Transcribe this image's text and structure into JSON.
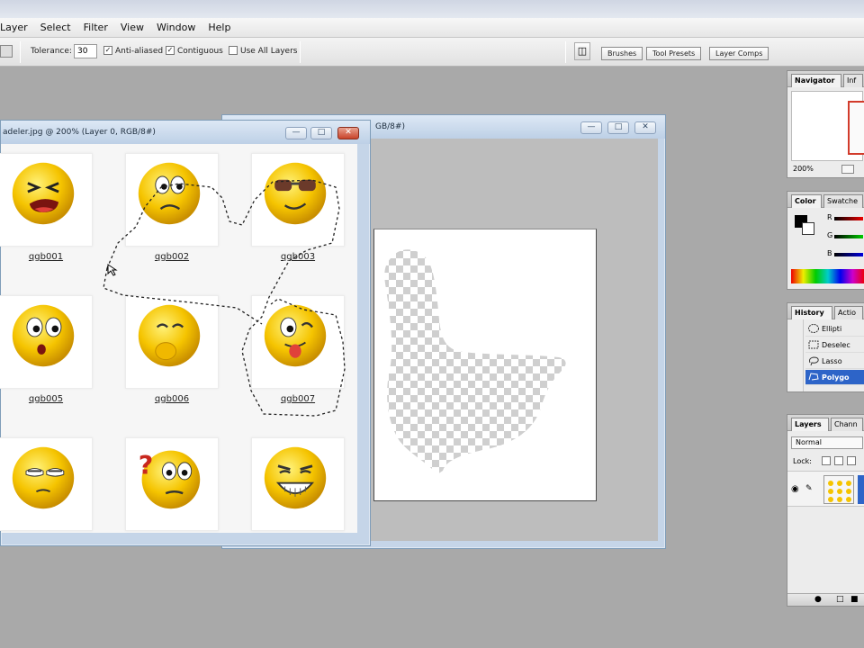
{
  "menu": [
    "Layer",
    "Select",
    "Filter",
    "View",
    "Window",
    "Help"
  ],
  "options": {
    "tolerance_label": "Tolerance:",
    "tolerance_value": "30",
    "anti_aliased_label": "Anti-aliased",
    "contiguous_label": "Contiguous",
    "use_all_layers_label": "Use All Layers",
    "anti_aliased": true,
    "contiguous": true,
    "use_all_layers": false
  },
  "palette_well": {
    "tabs": [
      "Brushes",
      "Tool Presets",
      "Layer Comps"
    ]
  },
  "windows": {
    "back": {
      "title": "GB/8#)",
      "min": "—",
      "max": "□",
      "close": "✕"
    },
    "front": {
      "title": "adeler.jpg @ 200% (Layer 0, RGB/8#)",
      "min": "—",
      "max": "□",
      "close": "✕",
      "emojis": [
        {
          "label": "qgb001",
          "expression": "squint-shout"
        },
        {
          "label": "qgb002",
          "expression": "worried"
        },
        {
          "label": "qgb003",
          "expression": "sunglasses"
        },
        {
          "label": "qgb005",
          "expression": "surprised"
        },
        {
          "label": "qgb006",
          "expression": "giggle"
        },
        {
          "label": "qgb007",
          "expression": "tongue-wink"
        },
        {
          "label": "",
          "expression": "sleepy"
        },
        {
          "label": "",
          "expression": "confused"
        },
        {
          "label": "",
          "expression": "big-grin"
        }
      ]
    }
  },
  "panels": {
    "navigator": {
      "tabs": [
        "Navigator",
        "Inf"
      ],
      "zoom": "200%"
    },
    "color": {
      "tabs": [
        "Color",
        "Swatche"
      ],
      "channels": [
        "R",
        "G",
        "B"
      ]
    },
    "history": {
      "tabs": [
        "History",
        "Actio"
      ],
      "items": [
        {
          "label": "Ellipti",
          "icon": "elliptical-marquee-icon"
        },
        {
          "label": "Deselec",
          "icon": "deselect-icon"
        },
        {
          "label": "Lasso",
          "icon": "lasso-icon"
        },
        {
          "label": "Polygo",
          "icon": "polygonal-lasso-icon",
          "selected": true
        }
      ]
    },
    "layers": {
      "tabs": [
        "Layers",
        "Chann"
      ],
      "blend_mode": "Normal",
      "lock_label": "Lock:"
    }
  },
  "colors": {
    "accent": "#2d64c8",
    "emoji_yellow": "#f5c400",
    "canvas_background": "#a9a9a9"
  }
}
